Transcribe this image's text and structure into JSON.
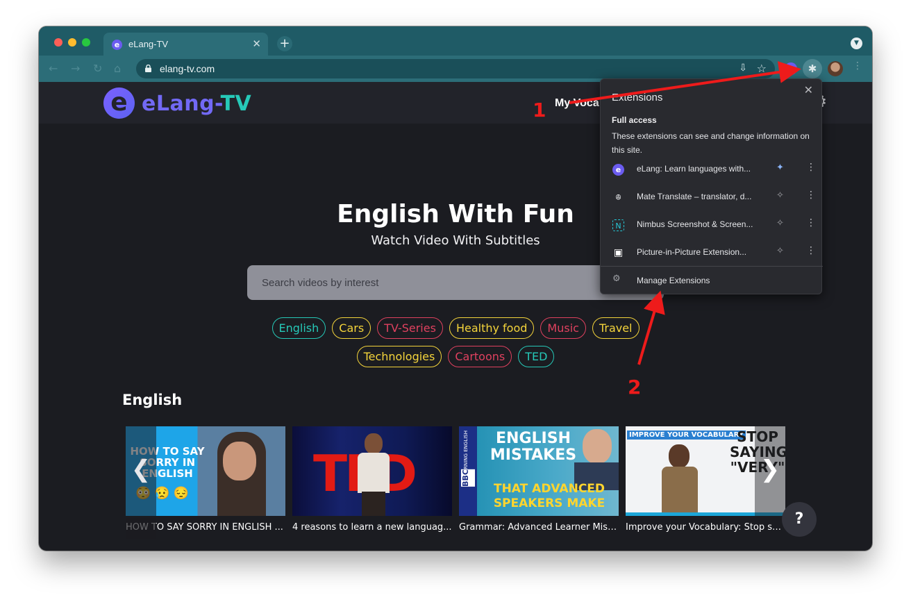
{
  "browser": {
    "tab_title": "eLang-TV",
    "tab_favicon": "e",
    "tab_close": "✕",
    "new_tab": "+",
    "url": "elang-tv.com",
    "nav_back": "←",
    "nav_forward": "→",
    "nav_reload": "↻",
    "nav_home": "⌂",
    "install_icon": "⇩",
    "star_icon": "☆",
    "puzzle_icon": "✱",
    "menu_icon": "⋮",
    "tab_menu_icon": "▼"
  },
  "site": {
    "logo_mark": "e",
    "logo_elang": "eLang-",
    "logo_tv": "TV",
    "nav_my_vocab": "My Voca",
    "settings_icon": "⚙",
    "hero_title": "English With Fun",
    "hero_subtitle": "Watch Video With Subtitles",
    "search_placeholder": "Search videos by interest",
    "tags": [
      {
        "label": "English",
        "color": "#26c9b8"
      },
      {
        "label": "Cars",
        "color": "#f4d43b"
      },
      {
        "label": "TV-Series",
        "color": "#e0415f"
      },
      {
        "label": "Healthy food",
        "color": "#f4d43b"
      },
      {
        "label": "Music",
        "color": "#e0415f"
      },
      {
        "label": "Travel",
        "color": "#f4d43b"
      },
      {
        "label": "Technologies",
        "color": "#f4d43b"
      },
      {
        "label": "Cartoons",
        "color": "#e0415f"
      },
      {
        "label": "TED",
        "color": "#26c9b8"
      }
    ],
    "section_title": "English",
    "videos": [
      {
        "title": "HOW TO SAY SORRY IN ENGLISH ...",
        "thumb_text": "HOW TO SAY SORRY IN ENGLISH",
        "emoji": "😳 😥 😔"
      },
      {
        "title": "4 reasons to learn a new languag...",
        "thumb_text": "TED"
      },
      {
        "title": "Grammar: Advanced Learner Mist...",
        "thumb_text_1": "ENGLISH MISTAKES",
        "thumb_text_2": "THAT ADVANCED SPEAKERS MAKE",
        "bbc": "BBC",
        "bbc_side": "LEARNING ENGLISH"
      },
      {
        "title": "Improve your Vocabulary: Stop sa...",
        "thumb_text_1": "IMPROVE YOUR VOCABULARY",
        "thumb_text_2": "STOP SAYING \"VERY\""
      }
    ],
    "prev_arrow": "❮",
    "next_arrow": "❯",
    "help_label": "?"
  },
  "extensions_popup": {
    "title": "Extensions",
    "close": "✕",
    "full_access_heading": "Full access",
    "full_access_desc": "These extensions can see and change information on this site.",
    "items": [
      {
        "name": "eLang: Learn languages with...",
        "icon": "e",
        "pinned": true
      },
      {
        "name": "Mate Translate – translator, d...",
        "icon": "ꔮ",
        "pinned": false
      },
      {
        "name": "Nimbus Screenshot & Screen...",
        "icon": "N",
        "pinned": false
      },
      {
        "name": "Picture-in-Picture Extension...",
        "icon": "▣",
        "pinned": false
      }
    ],
    "pin_icon": "📌",
    "more_icon": "⋮",
    "manage_icon": "⚙",
    "manage_label": "Manage Extensions"
  },
  "annotations": {
    "label_1": "1",
    "label_2": "2"
  },
  "colors": {
    "tab_strip": "#1f5b66",
    "toolbar": "#2c6d78",
    "page_bg": "#1b1c21",
    "accent_purple": "#7269f5",
    "accent_teal": "#26c9b8",
    "annotation_red": "#ee1b1b"
  }
}
